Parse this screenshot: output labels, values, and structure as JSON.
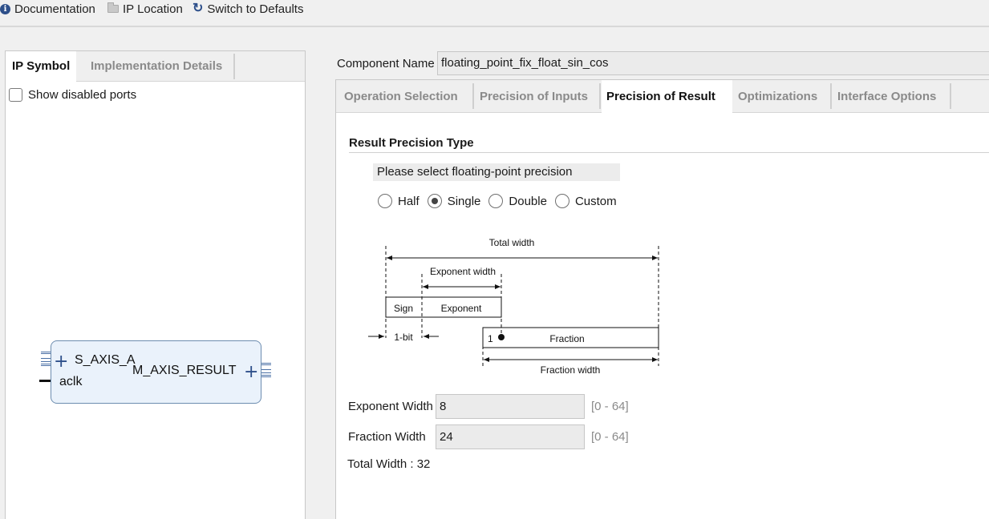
{
  "toolbar": {
    "documentation": "Documentation",
    "ip_location": "IP Location",
    "switch_defaults": "Switch to Defaults"
  },
  "left_panel": {
    "tabs": [
      "IP Symbol",
      "Implementation Details"
    ],
    "active_tab": "IP Symbol",
    "show_disabled_ports": "Show disabled ports",
    "show_disabled_ports_checked": false,
    "ip_block": {
      "input_bus": "S_AXIS_A",
      "clock": "aclk",
      "output_bus": "M_AXIS_RESULT"
    }
  },
  "component": {
    "label": "Component Name",
    "value": "floating_point_fix_float_sin_cos"
  },
  "right_panel": {
    "tabs": [
      "Operation Selection",
      "Precision of Inputs",
      "Precision of Result",
      "Optimizations",
      "Interface Options"
    ],
    "active_tab": "Precision of Result",
    "section_title": "Result Precision Type",
    "precision_prompt": "Please select floating-point precision",
    "precision_options": [
      "Half",
      "Single",
      "Double",
      "Custom"
    ],
    "selected_precision": "Single",
    "diagram": {
      "total_width": "Total width",
      "exponent_width": "Exponent width",
      "sign": "Sign",
      "exponent": "Exponent",
      "one_bit": "1-bit",
      "implicit_one": "1",
      "fraction": "Fraction",
      "fraction_width": "Fraction width"
    },
    "exponent_width": {
      "label": "Exponent Width",
      "value": "8",
      "range": "[0 - 64]"
    },
    "fraction_width": {
      "label": "Fraction Width",
      "value": "24",
      "range": "[0 - 64]"
    },
    "total_width": "Total Width : 32"
  }
}
